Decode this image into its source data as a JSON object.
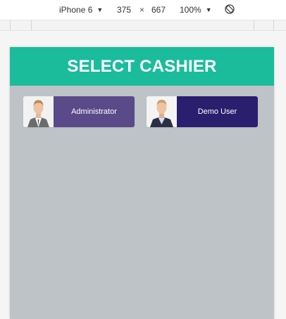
{
  "devtools": {
    "device": "iPhone 6",
    "width": "375",
    "times": "×",
    "height": "667",
    "zoom": "100%"
  },
  "header": {
    "title": "SELECT CASHIER"
  },
  "cashiers": [
    {
      "name": "Administrator",
      "color": "#5a4a8a"
    },
    {
      "name": "Demo User",
      "color": "#2a1e6e"
    }
  ],
  "colors": {
    "header_bg": "#1abc9c",
    "page_bg": "#bdc3c7"
  }
}
